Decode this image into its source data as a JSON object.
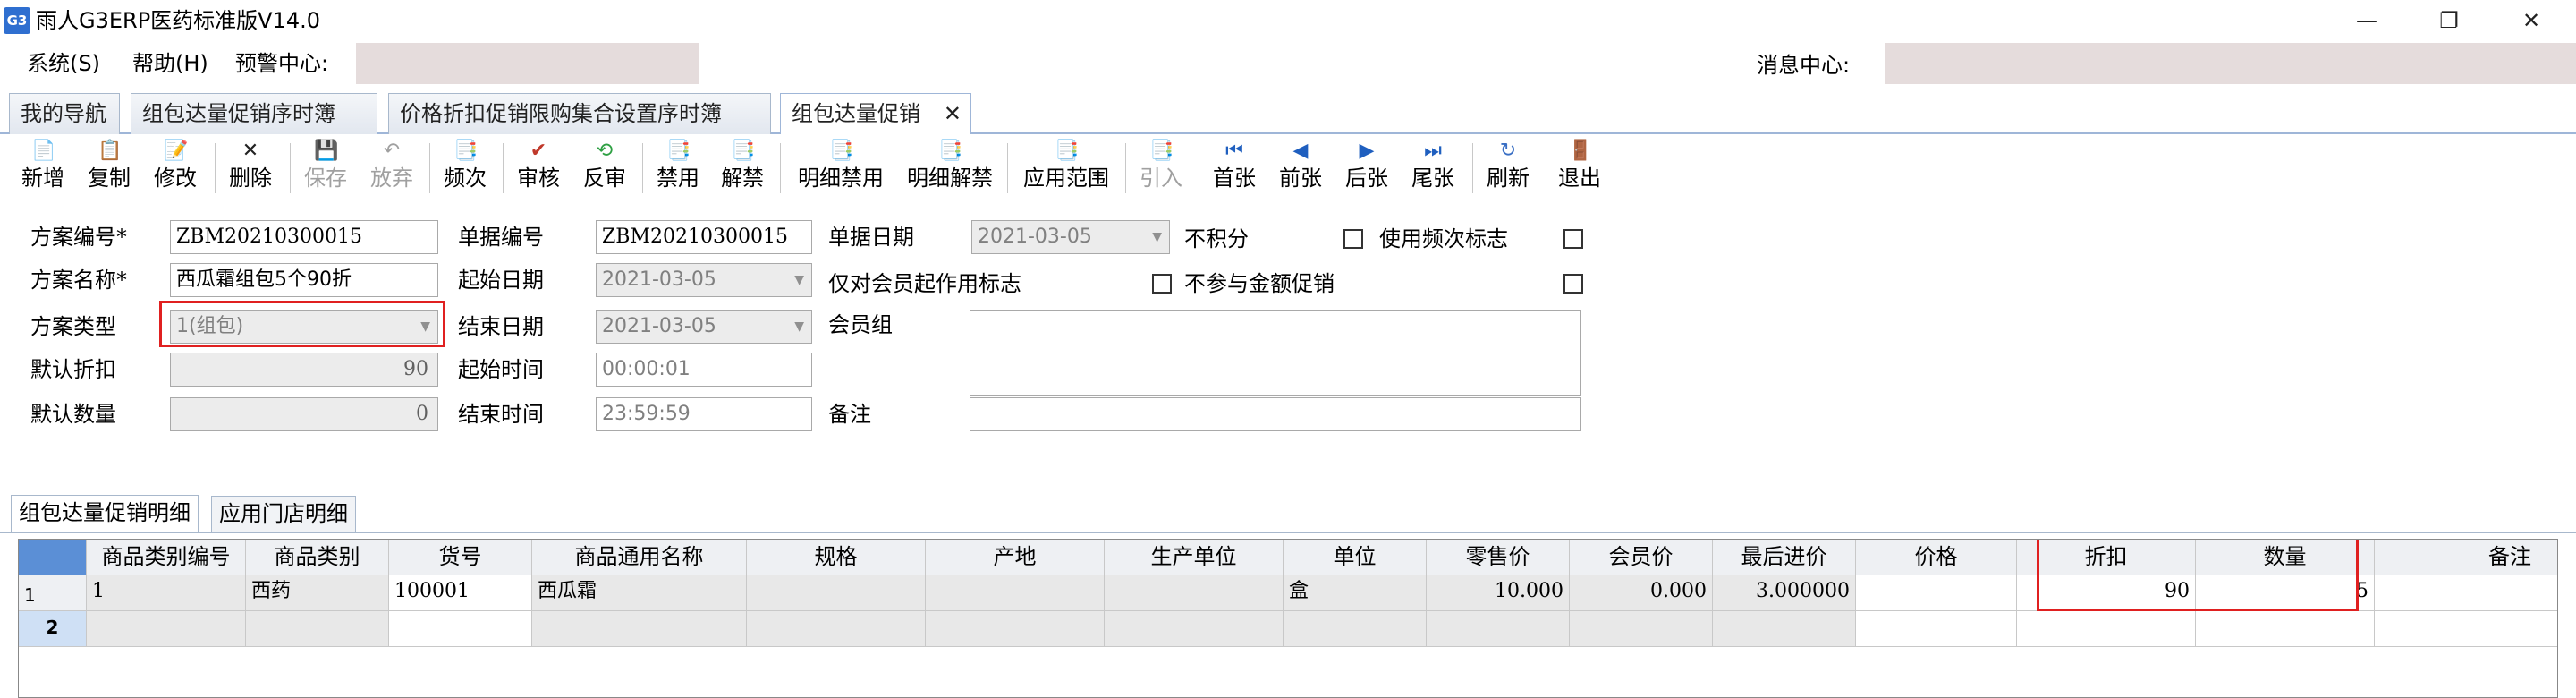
{
  "window": {
    "title": "雨人G3ERP医药标准版V14.0",
    "icon_text": "G3",
    "minimize": "—",
    "maximize": "❐",
    "close": "✕"
  },
  "menu": {
    "system": "系统(S)",
    "help": "帮助(H)",
    "warning_center": "预警中心:",
    "message_center": "消息中心:"
  },
  "tabs": [
    {
      "label": "我的导航"
    },
    {
      "label": "组包达量促销序时簿"
    },
    {
      "label": "价格折扣促销限购集合设置序时簿"
    },
    {
      "label": "组包达量促销",
      "close": "✕"
    }
  ],
  "toolbar": [
    {
      "label": "新增",
      "icon": "📄"
    },
    {
      "label": "复制",
      "icon": "📋"
    },
    {
      "label": "修改",
      "icon": "📝"
    },
    {
      "label": "删除",
      "icon": "✕"
    },
    {
      "label": "保存",
      "icon": "💾"
    },
    {
      "label": "放弃",
      "icon": "↶"
    },
    {
      "label": "频次",
      "icon": "📑"
    },
    {
      "label": "审核",
      "icon": "✔"
    },
    {
      "label": "反审",
      "icon": "⟲"
    },
    {
      "label": "禁用",
      "icon": "📑"
    },
    {
      "label": "解禁",
      "icon": "📑"
    },
    {
      "label": "明细禁用",
      "icon": "📑"
    },
    {
      "label": "明细解禁",
      "icon": "📑"
    },
    {
      "label": "应用范围",
      "icon": "📑"
    },
    {
      "label": "引入",
      "icon": "📑"
    },
    {
      "label": "首张",
      "icon": "⏮"
    },
    {
      "label": "前张",
      "icon": "◀"
    },
    {
      "label": "后张",
      "icon": "▶"
    },
    {
      "label": "尾张",
      "icon": "⏭"
    },
    {
      "label": "刷新",
      "icon": "↻"
    },
    {
      "label": "退出",
      "icon": "🚪"
    }
  ],
  "form": {
    "scheme_no_label": "方案编号*",
    "scheme_no": "ZBM20210300015",
    "scheme_name_label": "方案名称*",
    "scheme_name": "西瓜霜组包5个90折",
    "scheme_type_label": "方案类型",
    "scheme_type": "1(组包)",
    "default_discount_label": "默认折扣",
    "default_discount": "90",
    "default_qty_label": "默认数量",
    "default_qty": "0",
    "doc_no_label": "单据编号",
    "doc_no": "ZBM20210300015",
    "start_date_label": "起始日期",
    "start_date": "2021-03-05",
    "end_date_label": "结束日期",
    "end_date": "2021-03-05",
    "start_time_label": "起始时间",
    "start_time": "00:00:01",
    "end_time_label": "结束时间",
    "end_time": "23:59:59",
    "doc_date_label": "单据日期",
    "doc_date": "2021-03-05",
    "member_only_label": "仅对会员起作用标志",
    "member_group_label": "会员组",
    "remark_label": "备注",
    "no_points_label": "不积分",
    "use_frequency_label": "使用频次标志",
    "no_amount_promo_label": "不参与金额促销"
  },
  "subtabs": [
    {
      "label": "组包达量促销明细"
    },
    {
      "label": "应用门店明细"
    }
  ],
  "grid": {
    "columns": [
      "商品类别编号",
      "商品类别",
      "货号",
      "商品通用名称",
      "规格",
      "产地",
      "生产单位",
      "单位",
      "零售价",
      "会员价",
      "最后进价",
      "价格",
      "折扣",
      "数量",
      "备注"
    ],
    "rows": [
      {
        "num": "1",
        "cells": [
          "1",
          "西药",
          "100001",
          "西瓜霜",
          "",
          "",
          "",
          "盒",
          "10.000",
          "0.000",
          "3.000000",
          "",
          "90",
          "5",
          ""
        ]
      },
      {
        "num": "2",
        "cells": [
          "",
          "",
          "",
          "",
          "",
          "",
          "",
          "",
          "",
          "",
          "",
          "",
          "",
          "",
          ""
        ]
      }
    ]
  }
}
